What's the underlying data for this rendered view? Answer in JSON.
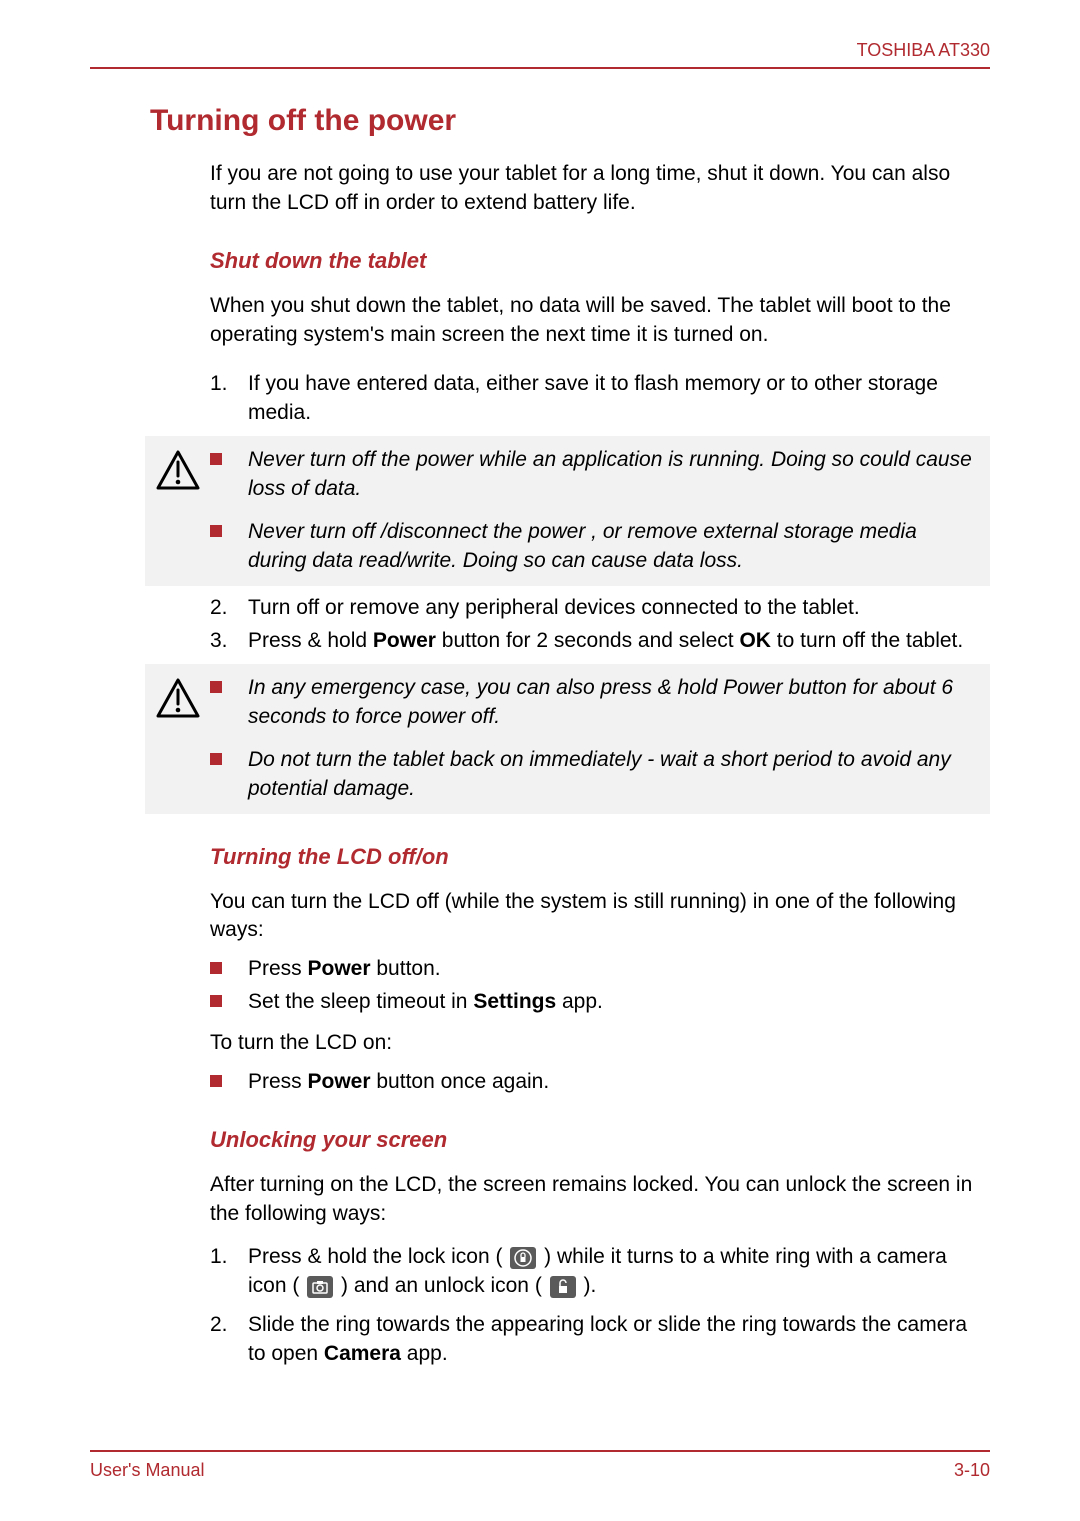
{
  "header": {
    "product": "TOSHIBA AT330"
  },
  "footer": {
    "left": "User's Manual",
    "right": "3-10"
  },
  "main": {
    "title": "Turning off the power",
    "intro": "If you are not going to use your tablet for a long time, shut it down. You can also turn the LCD off in order to extend battery life.",
    "shutdown": {
      "heading": "Shut down the tablet",
      "intro": "When you shut down the tablet, no data will be saved. The tablet will boot to the operating system's main screen the next time it is turned on.",
      "step1_num": "1.",
      "step1": "If you have entered data, either save it to flash memory or to other storage media.",
      "caution1_a": "Never turn off the power while an application is running. Doing so could cause loss of data.",
      "caution1_b": "Never turn off /disconnect the power , or remove external storage media during data read/write. Doing so can cause data loss.",
      "step2_num": "2.",
      "step2": "Turn off or remove any peripheral devices connected to the tablet.",
      "step3_num": "3.",
      "step3_pre": "Press & hold ",
      "step3_b1": "Power",
      "step3_mid": " button for 2 seconds and select ",
      "step3_b2": "OK",
      "step3_post": " to turn off the tablet.",
      "caution2_a": "In any emergency case, you can also press & hold Power button for about 6 seconds to force power off.",
      "caution2_b": "Do not turn the tablet back on immediately - wait a short period to avoid any potential damage."
    },
    "lcd": {
      "heading": "Turning the LCD off/on",
      "intro": "You can turn the LCD off (while the system is still running) in one of the following ways:",
      "b1_pre": "Press ",
      "b1_b": "Power",
      "b1_post": " button.",
      "b2_pre": "Set the sleep timeout in ",
      "b2_b": "Settings",
      "b2_post": " app.",
      "mid": "To turn the LCD on:",
      "b3_pre": "Press ",
      "b3_b": "Power",
      "b3_post": " button once again."
    },
    "unlock": {
      "heading": "Unlocking your screen",
      "intro": "After turning on the LCD, the screen remains locked. You can unlock the screen in the following ways:",
      "s1_num": "1.",
      "s1_a": "Press & hold the lock icon ( ",
      "s1_b": " ) while it turns to a white ring with a camera icon ( ",
      "s1_c": " ) and an unlock icon ( ",
      "s1_d": " ).",
      "s2_num": "2.",
      "s2_pre": "Slide the ring towards the appearing lock or slide the ring towards the camera to open ",
      "s2_b": "Camera",
      "s2_post": " app."
    }
  }
}
